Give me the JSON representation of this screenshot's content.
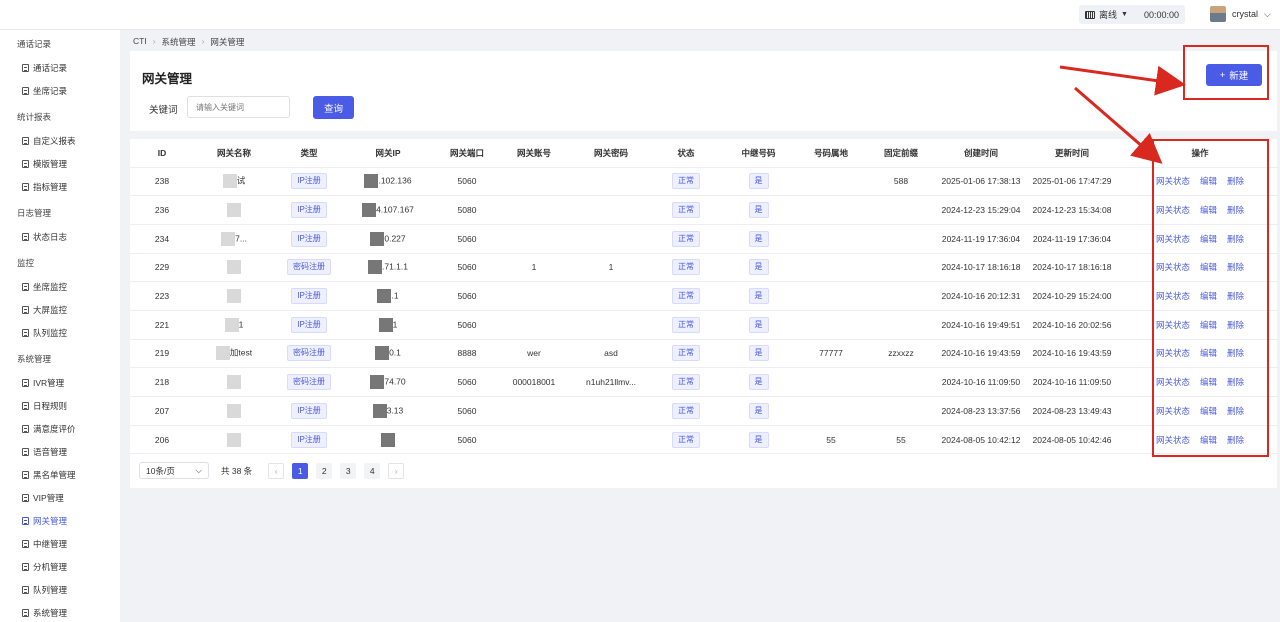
{
  "topbar": {
    "status": "离线",
    "timer": "00:00:00",
    "username": "crystal"
  },
  "sidebar": {
    "groups": [
      {
        "label": "通话记录",
        "items": [
          "通话记录",
          "坐席记录"
        ]
      },
      {
        "label": "统计报表",
        "items": [
          "自定义报表",
          "模版管理",
          "指标管理"
        ]
      },
      {
        "label": "日志管理",
        "items": [
          "状态日志"
        ]
      },
      {
        "label": "监控",
        "items": [
          "坐席监控",
          "大屏监控",
          "队列监控"
        ]
      },
      {
        "label": "系统管理",
        "items": [
          "IVR管理",
          "日程规则",
          "满意度评价",
          "语音管理",
          "黑名单管理",
          "VIP管理",
          "网关管理",
          "中继管理",
          "分机管理",
          "队列管理",
          "系统管理"
        ]
      }
    ],
    "active": "网关管理"
  },
  "breadcrumb": [
    "CTI",
    "系统管理",
    "网关管理"
  ],
  "page": {
    "title": "网关管理",
    "keyword_label": "关键词",
    "keyword_placeholder": "请输入关键词",
    "query_label": "查询",
    "new_label": "新建"
  },
  "table": {
    "headers": [
      "ID",
      "网关名称",
      "类型",
      "网关IP",
      "网关端口",
      "网关账号",
      "网关密码",
      "状态",
      "中继号码",
      "号码属地",
      "固定前缀",
      "创建时间",
      "更新时间",
      "操作"
    ],
    "rows": [
      {
        "id": "238",
        "name": "试",
        "type": "IP注册",
        "ip": ".102.136",
        "port": "5060",
        "account": "",
        "password": "",
        "status": "正常",
        "trunk": "是",
        "region": "",
        "prefix": "588",
        "created": "2025-01-06 17:38:13",
        "updated": "2025-01-06 17:47:29"
      },
      {
        "id": "236",
        "name": "",
        "type": "IP注册",
        "ip": "4.107.167",
        "port": "5080",
        "account": "",
        "password": "",
        "status": "正常",
        "trunk": "是",
        "region": "",
        "prefix": "",
        "created": "2024-12-23 15:29:04",
        "updated": "2024-12-23 15:34:08"
      },
      {
        "id": "234",
        "name": "7...",
        "type": "IP注册",
        "ip": "0.227",
        "port": "5060",
        "account": "",
        "password": "",
        "status": "正常",
        "trunk": "是",
        "region": "",
        "prefix": "",
        "created": "2024-11-19 17:36:04",
        "updated": "2024-11-19 17:36:04"
      },
      {
        "id": "229",
        "name": "",
        "type": "密码注册",
        "ip": ".71.1.1",
        "port": "5060",
        "account": "1",
        "password": "1",
        "status": "正常",
        "trunk": "是",
        "region": "",
        "prefix": "",
        "created": "2024-10-17 18:16:18",
        "updated": "2024-10-17 18:16:18"
      },
      {
        "id": "223",
        "name": "",
        "type": "IP注册",
        "ip": ".1",
        "port": "5060",
        "account": "",
        "password": "",
        "status": "正常",
        "trunk": "是",
        "region": "",
        "prefix": "",
        "created": "2024-10-16 20:12:31",
        "updated": "2024-10-29 15:24:00"
      },
      {
        "id": "221",
        "name": "1",
        "type": "IP注册",
        "ip": "1",
        "port": "5060",
        "account": "",
        "password": "",
        "status": "正常",
        "trunk": "是",
        "region": "",
        "prefix": "",
        "created": "2024-10-16 19:49:51",
        "updated": "2024-10-16 20:02:56"
      },
      {
        "id": "219",
        "name": "加test",
        "type": "密码注册",
        "ip": "0.1",
        "port": "8888",
        "account": "wer",
        "password": "asd",
        "status": "正常",
        "trunk": "是",
        "region": "77777",
        "prefix": "zzxxzz",
        "created": "2024-10-16 19:43:59",
        "updated": "2024-10-16 19:43:59"
      },
      {
        "id": "218",
        "name": "",
        "type": "密码注册",
        "ip": "74.70",
        "port": "5060",
        "account": "000018001",
        "password": "n1uh21llmv...",
        "status": "正常",
        "trunk": "是",
        "region": "",
        "prefix": "",
        "created": "2024-10-16 11:09:50",
        "updated": "2024-10-16 11:09:50"
      },
      {
        "id": "207",
        "name": "",
        "type": "IP注册",
        "ip": "3.13",
        "port": "5060",
        "account": "",
        "password": "",
        "status": "正常",
        "trunk": "是",
        "region": "",
        "prefix": "",
        "created": "2024-08-23 13:37:56",
        "updated": "2024-08-23 13:49:43"
      },
      {
        "id": "206",
        "name": "",
        "type": "IP注册",
        "ip": "",
        "port": "5060",
        "account": "",
        "password": "",
        "status": "正常",
        "trunk": "是",
        "region": "55",
        "prefix": "55",
        "created": "2024-08-05 10:42:12",
        "updated": "2024-08-05 10:42:46"
      }
    ],
    "actions": [
      "网关状态",
      "编辑",
      "删除"
    ]
  },
  "pagination": {
    "page_size": "10条/页",
    "total": "共 38 条",
    "pages": [
      "1",
      "2",
      "3",
      "4"
    ],
    "current": "1"
  },
  "colors": {
    "primary": "#4a5be6",
    "annotation": "#d9281e"
  }
}
